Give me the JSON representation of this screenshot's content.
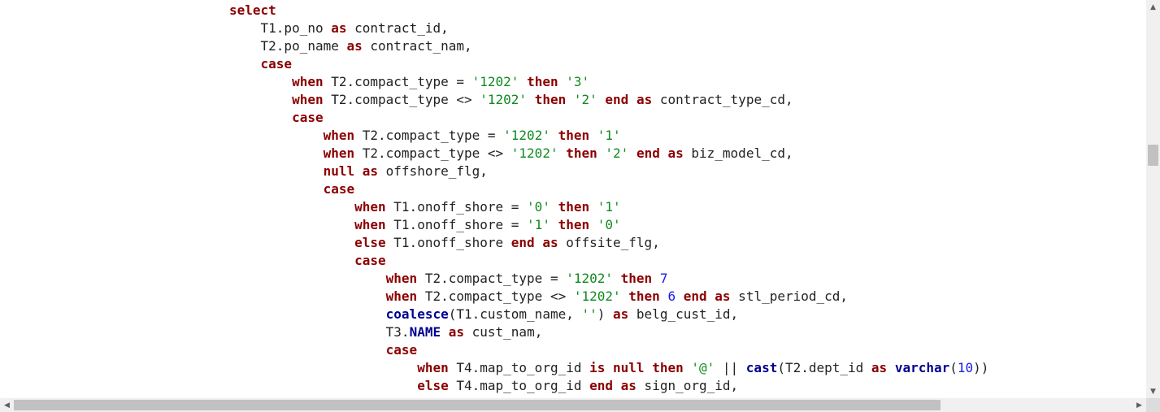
{
  "code_lines": [
    [
      {
        "t": "select",
        "c": "kw"
      }
    ],
    [
      {
        "t": "    T1.po_no ",
        "c": "plain"
      },
      {
        "t": "as",
        "c": "kw"
      },
      {
        "t": " contract_id,",
        "c": "plain"
      }
    ],
    [
      {
        "t": "    T2.po_name ",
        "c": "plain"
      },
      {
        "t": "as",
        "c": "kw"
      },
      {
        "t": " contract_nam,",
        "c": "plain"
      }
    ],
    [
      {
        "t": "    ",
        "c": "plain"
      },
      {
        "t": "case",
        "c": "kw"
      }
    ],
    [
      {
        "t": "        ",
        "c": "plain"
      },
      {
        "t": "when",
        "c": "kw"
      },
      {
        "t": " T2.compact_type = ",
        "c": "plain"
      },
      {
        "t": "'1202'",
        "c": "str"
      },
      {
        "t": " ",
        "c": "plain"
      },
      {
        "t": "then",
        "c": "kw"
      },
      {
        "t": " ",
        "c": "plain"
      },
      {
        "t": "'3'",
        "c": "str"
      }
    ],
    [
      {
        "t": "        ",
        "c": "plain"
      },
      {
        "t": "when",
        "c": "kw"
      },
      {
        "t": " T2.compact_type <> ",
        "c": "plain"
      },
      {
        "t": "'1202'",
        "c": "str"
      },
      {
        "t": " ",
        "c": "plain"
      },
      {
        "t": "then",
        "c": "kw"
      },
      {
        "t": " ",
        "c": "plain"
      },
      {
        "t": "'2'",
        "c": "str"
      },
      {
        "t": " ",
        "c": "plain"
      },
      {
        "t": "end",
        "c": "kw"
      },
      {
        "t": " ",
        "c": "plain"
      },
      {
        "t": "as",
        "c": "kw"
      },
      {
        "t": " contract_type_cd,",
        "c": "plain"
      }
    ],
    [
      {
        "t": "        ",
        "c": "plain"
      },
      {
        "t": "case",
        "c": "kw"
      }
    ],
    [
      {
        "t": "            ",
        "c": "plain"
      },
      {
        "t": "when",
        "c": "kw"
      },
      {
        "t": " T2.compact_type = ",
        "c": "plain"
      },
      {
        "t": "'1202'",
        "c": "str"
      },
      {
        "t": " ",
        "c": "plain"
      },
      {
        "t": "then",
        "c": "kw"
      },
      {
        "t": " ",
        "c": "plain"
      },
      {
        "t": "'1'",
        "c": "str"
      }
    ],
    [
      {
        "t": "            ",
        "c": "plain"
      },
      {
        "t": "when",
        "c": "kw"
      },
      {
        "t": " T2.compact_type <> ",
        "c": "plain"
      },
      {
        "t": "'1202'",
        "c": "str"
      },
      {
        "t": " ",
        "c": "plain"
      },
      {
        "t": "then",
        "c": "kw"
      },
      {
        "t": " ",
        "c": "plain"
      },
      {
        "t": "'2'",
        "c": "str"
      },
      {
        "t": " ",
        "c": "plain"
      },
      {
        "t": "end",
        "c": "kw"
      },
      {
        "t": " ",
        "c": "plain"
      },
      {
        "t": "as",
        "c": "kw"
      },
      {
        "t": " biz_model_cd,",
        "c": "plain"
      }
    ],
    [
      {
        "t": "            ",
        "c": "plain"
      },
      {
        "t": "null",
        "c": "kw"
      },
      {
        "t": " ",
        "c": "plain"
      },
      {
        "t": "as",
        "c": "kw"
      },
      {
        "t": " offshore_flg,",
        "c": "plain"
      }
    ],
    [
      {
        "t": "            ",
        "c": "plain"
      },
      {
        "t": "case",
        "c": "kw"
      }
    ],
    [
      {
        "t": "                ",
        "c": "plain"
      },
      {
        "t": "when",
        "c": "kw"
      },
      {
        "t": " T1.onoff_shore = ",
        "c": "plain"
      },
      {
        "t": "'0'",
        "c": "str"
      },
      {
        "t": " ",
        "c": "plain"
      },
      {
        "t": "then",
        "c": "kw"
      },
      {
        "t": " ",
        "c": "plain"
      },
      {
        "t": "'1'",
        "c": "str"
      }
    ],
    [
      {
        "t": "                ",
        "c": "plain"
      },
      {
        "t": "when",
        "c": "kw"
      },
      {
        "t": " T1.onoff_shore = ",
        "c": "plain"
      },
      {
        "t": "'1'",
        "c": "str"
      },
      {
        "t": " ",
        "c": "plain"
      },
      {
        "t": "then",
        "c": "kw"
      },
      {
        "t": " ",
        "c": "plain"
      },
      {
        "t": "'0'",
        "c": "str"
      }
    ],
    [
      {
        "t": "                ",
        "c": "plain"
      },
      {
        "t": "else",
        "c": "kw"
      },
      {
        "t": " T1.onoff_shore ",
        "c": "plain"
      },
      {
        "t": "end",
        "c": "kw"
      },
      {
        "t": " ",
        "c": "plain"
      },
      {
        "t": "as",
        "c": "kw"
      },
      {
        "t": " offsite_flg,",
        "c": "plain"
      }
    ],
    [
      {
        "t": "                ",
        "c": "plain"
      },
      {
        "t": "case",
        "c": "kw"
      }
    ],
    [
      {
        "t": "                    ",
        "c": "plain"
      },
      {
        "t": "when",
        "c": "kw"
      },
      {
        "t": " T2.compact_type = ",
        "c": "plain"
      },
      {
        "t": "'1202'",
        "c": "str"
      },
      {
        "t": " ",
        "c": "plain"
      },
      {
        "t": "then",
        "c": "kw"
      },
      {
        "t": " ",
        "c": "plain"
      },
      {
        "t": "7",
        "c": "num"
      }
    ],
    [
      {
        "t": "                    ",
        "c": "plain"
      },
      {
        "t": "when",
        "c": "kw"
      },
      {
        "t": " T2.compact_type <> ",
        "c": "plain"
      },
      {
        "t": "'1202'",
        "c": "str"
      },
      {
        "t": " ",
        "c": "plain"
      },
      {
        "t": "then",
        "c": "kw"
      },
      {
        "t": " ",
        "c": "plain"
      },
      {
        "t": "6",
        "c": "num"
      },
      {
        "t": " ",
        "c": "plain"
      },
      {
        "t": "end",
        "c": "kw"
      },
      {
        "t": " ",
        "c": "plain"
      },
      {
        "t": "as",
        "c": "kw"
      },
      {
        "t": " stl_period_cd,",
        "c": "plain"
      }
    ],
    [
      {
        "t": "                    ",
        "c": "plain"
      },
      {
        "t": "coalesce",
        "c": "fn"
      },
      {
        "t": "(T1.custom_name, ",
        "c": "plain"
      },
      {
        "t": "''",
        "c": "str"
      },
      {
        "t": ") ",
        "c": "plain"
      },
      {
        "t": "as",
        "c": "kw"
      },
      {
        "t": " belg_cust_id,",
        "c": "plain"
      }
    ],
    [
      {
        "t": "                    T3.",
        "c": "plain"
      },
      {
        "t": "NAME",
        "c": "fn"
      },
      {
        "t": " ",
        "c": "plain"
      },
      {
        "t": "as",
        "c": "kw"
      },
      {
        "t": " cust_nam,",
        "c": "plain"
      }
    ],
    [
      {
        "t": "                    ",
        "c": "plain"
      },
      {
        "t": "case",
        "c": "kw"
      }
    ],
    [
      {
        "t": "                        ",
        "c": "plain"
      },
      {
        "t": "when",
        "c": "kw"
      },
      {
        "t": " T4.map_to_org_id ",
        "c": "plain"
      },
      {
        "t": "is null",
        "c": "kw"
      },
      {
        "t": " ",
        "c": "plain"
      },
      {
        "t": "then",
        "c": "kw"
      },
      {
        "t": " ",
        "c": "plain"
      },
      {
        "t": "'@'",
        "c": "str"
      },
      {
        "t": " || ",
        "c": "plain"
      },
      {
        "t": "cast",
        "c": "fn"
      },
      {
        "t": "(T2.dept_id ",
        "c": "plain"
      },
      {
        "t": "as",
        "c": "kw"
      },
      {
        "t": " ",
        "c": "plain"
      },
      {
        "t": "varchar",
        "c": "fn"
      },
      {
        "t": "(",
        "c": "plain"
      },
      {
        "t": "10",
        "c": "num"
      },
      {
        "t": "))",
        "c": "plain"
      }
    ],
    [
      {
        "t": "                        ",
        "c": "plain"
      },
      {
        "t": "else",
        "c": "kw"
      },
      {
        "t": " T4.map_to_org_id ",
        "c": "plain"
      },
      {
        "t": "end",
        "c": "kw"
      },
      {
        "t": " ",
        "c": "plain"
      },
      {
        "t": "as",
        "c": "kw"
      },
      {
        "t": " sign_org_id,",
        "c": "plain"
      }
    ]
  ],
  "scrollbars": {
    "up_arrow": "▲",
    "down_arrow": "▼",
    "left_arrow": "◀",
    "right_arrow": "▶"
  },
  "colors": {
    "keyword": "#8b0000",
    "function": "#000090",
    "string": "#0f8a1f",
    "number": "#1a1aee",
    "text": "#222222"
  }
}
